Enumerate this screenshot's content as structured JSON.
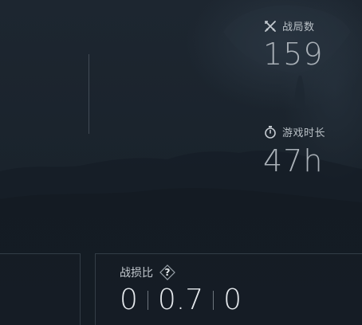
{
  "stats": {
    "matches": {
      "label": "战局数",
      "value": "159",
      "icon": "crossed-swords-icon"
    },
    "playtime": {
      "label": "游戏时长",
      "value": "47h",
      "icon": "stopwatch-icon"
    }
  },
  "kd": {
    "label": "战损比",
    "help": "?",
    "kills": "0",
    "ratio": "0.7",
    "deaths": "0"
  }
}
